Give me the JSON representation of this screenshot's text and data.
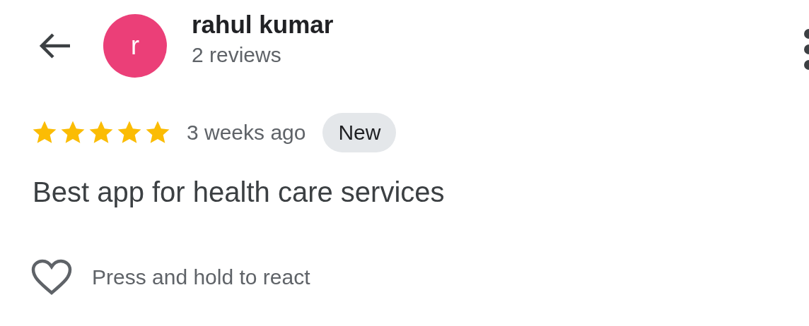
{
  "reviewer": {
    "initial": "r",
    "name": "rahul kumar",
    "reviews": "2 reviews",
    "color": "#eb3f78"
  },
  "review": {
    "stars": 5,
    "time": "3 weeks ago",
    "badge": "New",
    "text": "Best app for health care services"
  },
  "reaction": {
    "hint": "Press and hold to react"
  }
}
